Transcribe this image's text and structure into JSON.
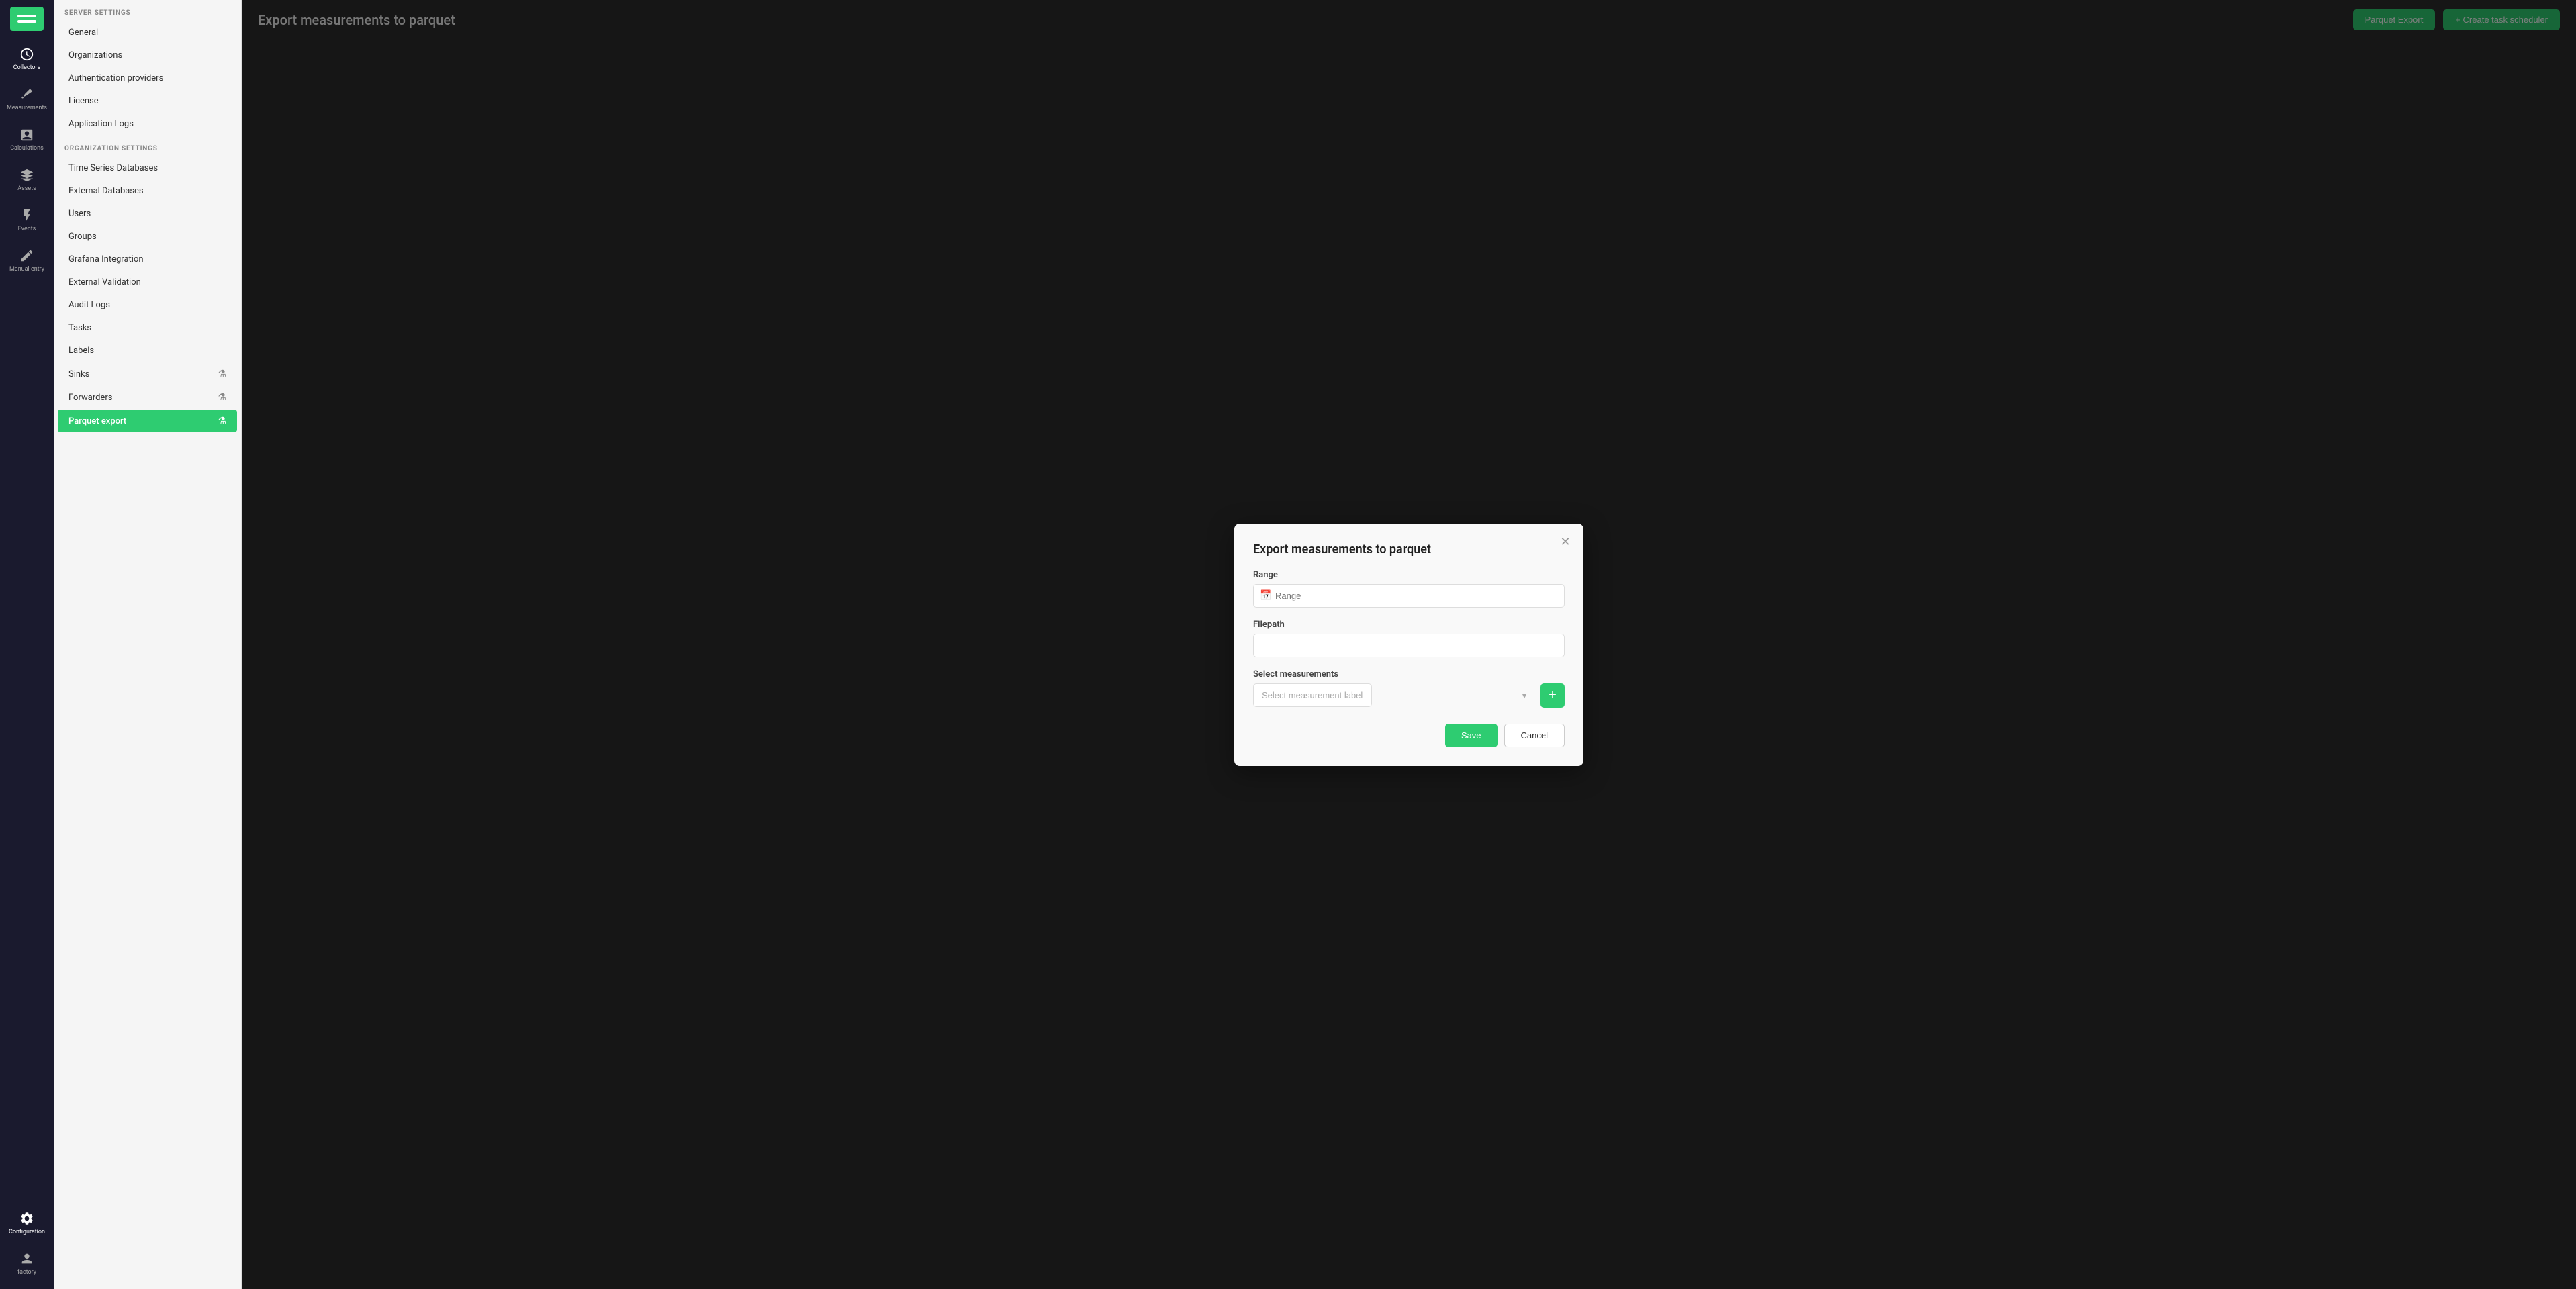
{
  "app": {
    "logo_bars": 2
  },
  "nav": {
    "items": [
      {
        "id": "collectors",
        "label": "Collectors",
        "icon": "clock-icon"
      },
      {
        "id": "measurements",
        "label": "Measurements",
        "icon": "ruler-icon"
      },
      {
        "id": "calculations",
        "label": "Calculations",
        "icon": "table-icon"
      },
      {
        "id": "assets",
        "label": "Assets",
        "icon": "cube-icon"
      },
      {
        "id": "events",
        "label": "Events",
        "icon": "bolt-icon"
      },
      {
        "id": "manual-entry",
        "label": "Manual entry",
        "icon": "pen-icon"
      },
      {
        "id": "configuration",
        "label": "Configuration",
        "icon": "gear-icon",
        "active": true
      },
      {
        "id": "factory",
        "label": "factory",
        "icon": "factory-icon"
      }
    ]
  },
  "sidebar": {
    "server_settings_title": "SERVER SETTINGS",
    "org_settings_title": "ORGANIZATION SETTINGS",
    "server_items": [
      {
        "id": "general",
        "label": "General",
        "active": false
      },
      {
        "id": "organizations",
        "label": "Organizations",
        "active": false
      },
      {
        "id": "authentication-providers",
        "label": "Authentication providers",
        "active": false
      },
      {
        "id": "license",
        "label": "License",
        "active": false
      },
      {
        "id": "application-logs",
        "label": "Application Logs",
        "active": false
      }
    ],
    "org_items": [
      {
        "id": "time-series-databases",
        "label": "Time Series Databases",
        "active": false
      },
      {
        "id": "external-databases",
        "label": "External Databases",
        "active": false
      },
      {
        "id": "users",
        "label": "Users",
        "active": false
      },
      {
        "id": "groups",
        "label": "Groups",
        "active": false
      },
      {
        "id": "grafana-integration",
        "label": "Grafana Integration",
        "active": false
      },
      {
        "id": "external-validation",
        "label": "External Validation",
        "active": false
      },
      {
        "id": "audit-logs",
        "label": "Audit Logs",
        "active": false
      },
      {
        "id": "tasks",
        "label": "Tasks",
        "active": false
      },
      {
        "id": "labels",
        "label": "Labels",
        "active": false
      },
      {
        "id": "sinks",
        "label": "Sinks",
        "active": false,
        "has_icon": true
      },
      {
        "id": "forwarders",
        "label": "Forwarders",
        "active": false,
        "has_icon": true
      },
      {
        "id": "parquet-export",
        "label": "Parquet export",
        "active": true,
        "has_icon": true
      }
    ]
  },
  "main": {
    "page_title": "Export measurements to parquet",
    "btn_parquet_export": "Parquet Export",
    "btn_create_task": "+ Create task scheduler"
  },
  "modal": {
    "title": "Export measurements to parquet",
    "range_label": "Range",
    "range_placeholder": "Range",
    "filepath_label": "Filepath",
    "filepath_placeholder": "",
    "select_measurements_label": "Select measurements",
    "select_measurement_placeholder": "Select measurement label",
    "btn_save": "Save",
    "btn_cancel": "Cancel"
  }
}
